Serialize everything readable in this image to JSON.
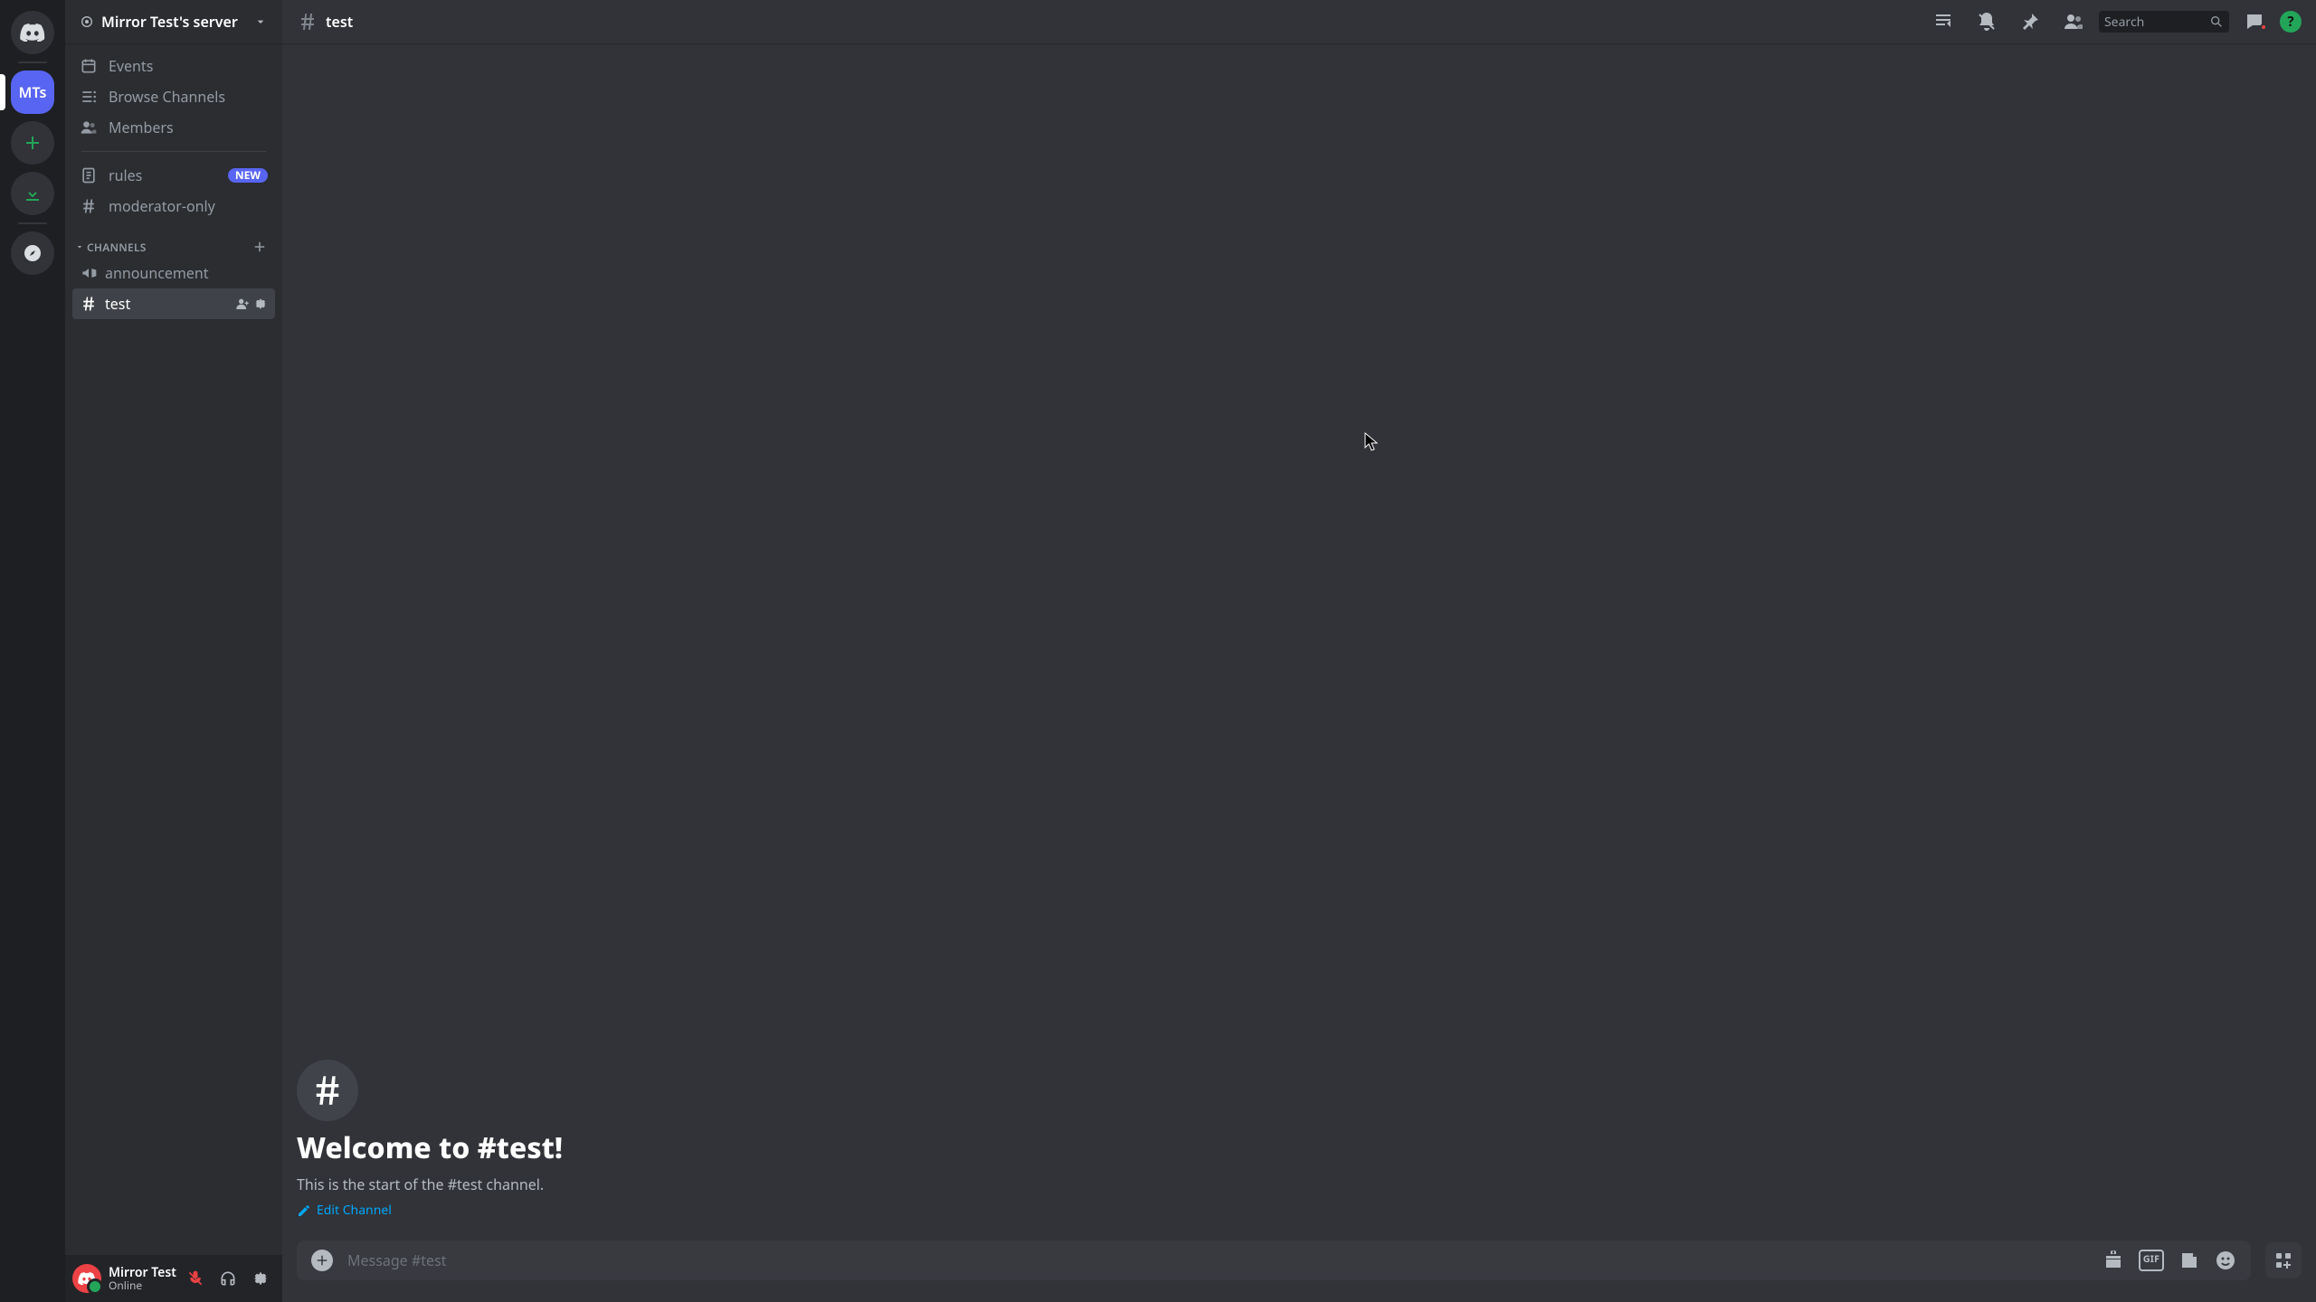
{
  "server": {
    "name": "Mirror Test's server",
    "initials": "MTs"
  },
  "sidebar": {
    "events": "Events",
    "browse": "Browse Channels",
    "members": "Members",
    "rules": "rules",
    "rules_badge": "NEW",
    "moderator": "moderator-only",
    "category": "CHANNELS",
    "announcement": "announcement",
    "test": "test"
  },
  "header": {
    "channel": "test",
    "search_placeholder": "Search"
  },
  "welcome": {
    "title": "Welcome to #test!",
    "subtitle": "This is the start of the #test channel.",
    "edit": "Edit Channel"
  },
  "input": {
    "placeholder": "Message #test"
  },
  "user": {
    "name": "Mirror Test",
    "status": "Online"
  },
  "help": {
    "glyph": "?"
  },
  "gif_label": "GIF"
}
